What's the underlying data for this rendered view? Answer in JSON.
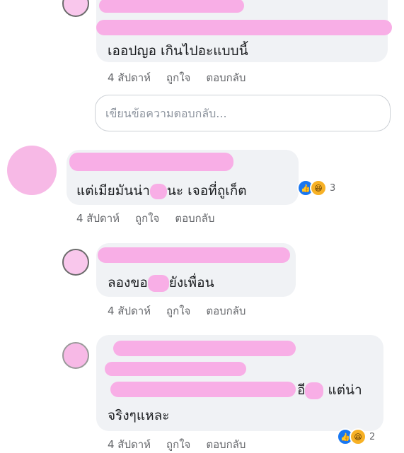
{
  "comments": [
    {
      "text_line1": "เออปญอ เกินไปอะแบบนี้",
      "time": "4 สัปดาห์",
      "like": "ถูกใจ",
      "reply": "ตอบกลับ"
    },
    {
      "text_line1": "แต่เมียมันน่า",
      "text_line1b": "นะ เจอที่ถูเก็ต",
      "reaction_count": "3",
      "time": "4 สัปดาห์",
      "like": "ถูกใจ",
      "reply": "ตอบกลับ"
    },
    {
      "text_line1": "ลองขอ",
      "text_line1b": "ยังเพื่อน",
      "time": "4 สัปดาห์",
      "like": "ถูกใจ",
      "reply": "ตอบกลับ"
    },
    {
      "text_line1a": "อี",
      "text_line1b": "แต่น่า",
      "text_line2": "จริงๆแหละ",
      "reaction_count": "2",
      "time": "4 สัปดาห์",
      "like": "ถูกใจ",
      "reply": "ตอบกลับ"
    }
  ],
  "reply_box": {
    "placeholder": "เขียนข้อความตอบกลับ..."
  },
  "icons": {
    "like": "like-icon",
    "haha": "haha-icon"
  },
  "colors": {
    "bubble": "#f0f2f5",
    "redaction": "#f8aee6",
    "like_blue": "#1877f2"
  }
}
